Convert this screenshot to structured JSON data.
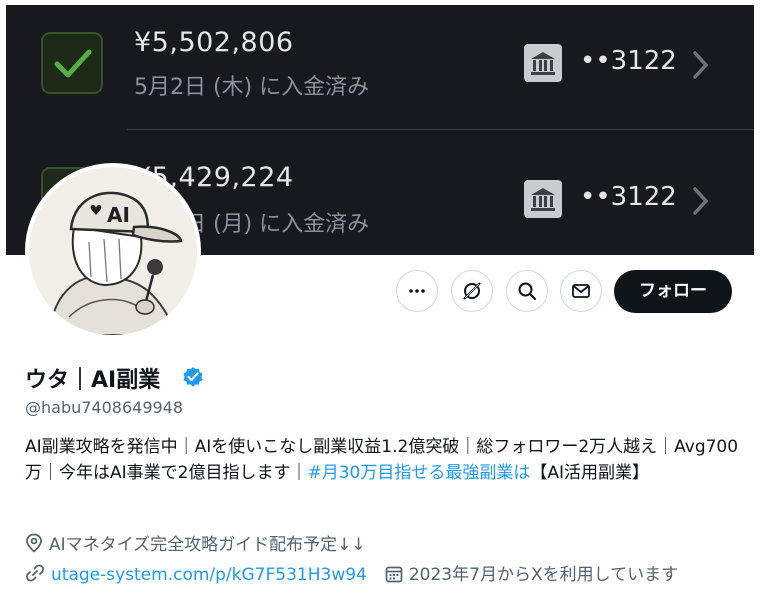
{
  "banner": {
    "payments": [
      {
        "amount": "¥5,502,806",
        "status": "5月2日 (木) に入金済み",
        "account": "••3122"
      },
      {
        "amount": "¥5,429,224",
        "status": "5月6日 (月) に入金済み",
        "account": "••3122"
      }
    ],
    "icons": {
      "check": "check-icon",
      "bank": "bank-icon",
      "chevron": "chevron-right-icon"
    }
  },
  "profile": {
    "display_name": "ウタ｜AI副業",
    "handle": "@habu7408649948",
    "bio_parts": {
      "before": "AI副業攻略を発信中｜AIを使いこなし副業収益1.2億突破｜総フォロワー2万人越え｜Avg700万｜今年はAI事業で2億目指します｜",
      "hashtag": "#月30万目指せる最強副業は",
      "after": "【AI活用副業】"
    },
    "location": "AIマネタイズ完全攻略ガイド配布予定↓↓",
    "url": "utage-system.com/p/kG7F531H3w94",
    "joined": "2023年7月からXを利用しています"
  },
  "actions": {
    "follow_label": "フォロー",
    "buttons": [
      "more-icon",
      "grok-icon",
      "search-icon",
      "message-icon"
    ]
  },
  "colors": {
    "accent": "#1d9bf0",
    "banner_bg": "#17191f",
    "check_green": "#4caf50"
  }
}
